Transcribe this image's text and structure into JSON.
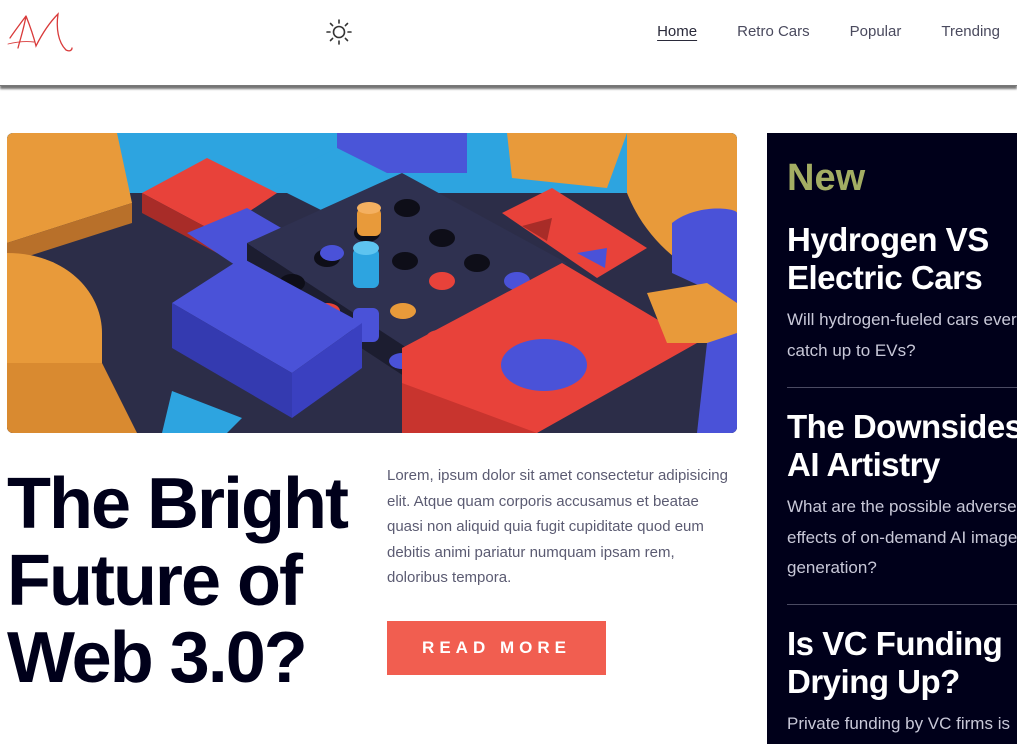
{
  "header": {
    "logo_icon": "handwritten-m-logo",
    "theme_icon": "sun-icon",
    "nav": [
      {
        "label": "Home",
        "active": true
      },
      {
        "label": "Retro Cars",
        "active": false
      },
      {
        "label": "Popular",
        "active": false
      },
      {
        "label": "Trending",
        "active": false
      }
    ]
  },
  "hero": {
    "image_icon": "abstract-3d-blocks-image",
    "headline_lines": [
      "The Bright",
      "Future of",
      "Web 3.0?"
    ],
    "excerpt": "Lorem, ipsum dolor sit amet consectetur adipisicing elit. Atque quam corporis accusamus et beatae quasi non aliquid quia fugit cupiditate quod eum debitis animi pariatur numquam ipsam rem, doloribus tempora.",
    "read_more_label": "READ MORE"
  },
  "new_section": {
    "title": "New",
    "accent_color": "#a3ad63",
    "items": [
      {
        "title": "Hydrogen VS Electric Cars",
        "summary": "Will hydrogen-fueled cars ever catch up to EVs?"
      },
      {
        "title": "The Downsides of AI Artistry",
        "summary": "What are the possible adverse effects of on-demand AI image generation?"
      },
      {
        "title": "Is VC Funding Drying Up?",
        "summary": "Private funding by VC firms is down"
      }
    ]
  },
  "colors": {
    "dark_navy": "#00001a",
    "button_red": "#f15e50",
    "text_gray": "#5b5b72"
  }
}
